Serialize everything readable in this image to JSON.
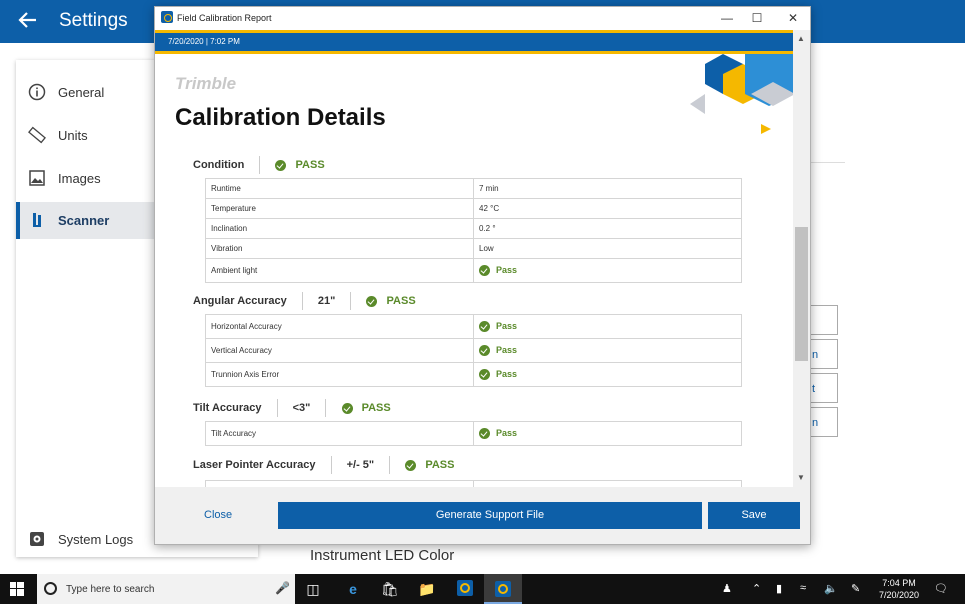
{
  "settings_app": {
    "title": "Settings",
    "nav": [
      {
        "label": "General",
        "icon": "info-icon"
      },
      {
        "label": "Units",
        "icon": "ruler-icon"
      },
      {
        "label": "Images",
        "icon": "image-icon"
      },
      {
        "label": "Scanner",
        "icon": "scanner-icon",
        "active": true
      },
      {
        "label": "System Logs",
        "icon": "gear-icon"
      }
    ],
    "bg_buttons": [
      "",
      "n",
      "t",
      "n"
    ],
    "led_label": "Instrument LED Color"
  },
  "dialog": {
    "title": "Field Calibration Report",
    "datetime": "7/20/2020 | 7:02 PM",
    "brand": "Trimble",
    "heading": "Calibration Details",
    "sections": [
      {
        "name": "Condition",
        "value": "",
        "status": "PASS",
        "rows": [
          {
            "label": "Runtime",
            "value": "7 min"
          },
          {
            "label": "Temperature",
            "value": "42 °C"
          },
          {
            "label": "Inclination",
            "value": "0.2 °"
          },
          {
            "label": "Vibration",
            "value": "Low"
          },
          {
            "label": "Ambient light",
            "value": "Pass"
          }
        ]
      },
      {
        "name": "Angular Accuracy",
        "value": "21\"",
        "status": "PASS",
        "rows": [
          {
            "label": "Horizontal Accuracy",
            "value": "Pass"
          },
          {
            "label": "Vertical Accuracy",
            "value": "Pass"
          },
          {
            "label": "Trunnion Axis Error",
            "value": "Pass"
          }
        ]
      },
      {
        "name": "Tilt Accuracy",
        "value": "<3\"",
        "status": "PASS",
        "rows": [
          {
            "label": "Tilt Accuracy",
            "value": "Pass"
          }
        ]
      },
      {
        "name": "Laser Pointer Accuracy",
        "value": "+/- 5\"",
        "status": "PASS",
        "rows": []
      }
    ],
    "footer": {
      "close": "Close",
      "generate": "Generate Support File",
      "save": "Save"
    }
  },
  "taskbar": {
    "search_placeholder": "Type here to search",
    "time": "7:04 PM",
    "date": "7/20/2020"
  },
  "colors": {
    "accent": "#0d5fa8",
    "gold": "#f5b800",
    "pass": "#5a8a2a"
  }
}
